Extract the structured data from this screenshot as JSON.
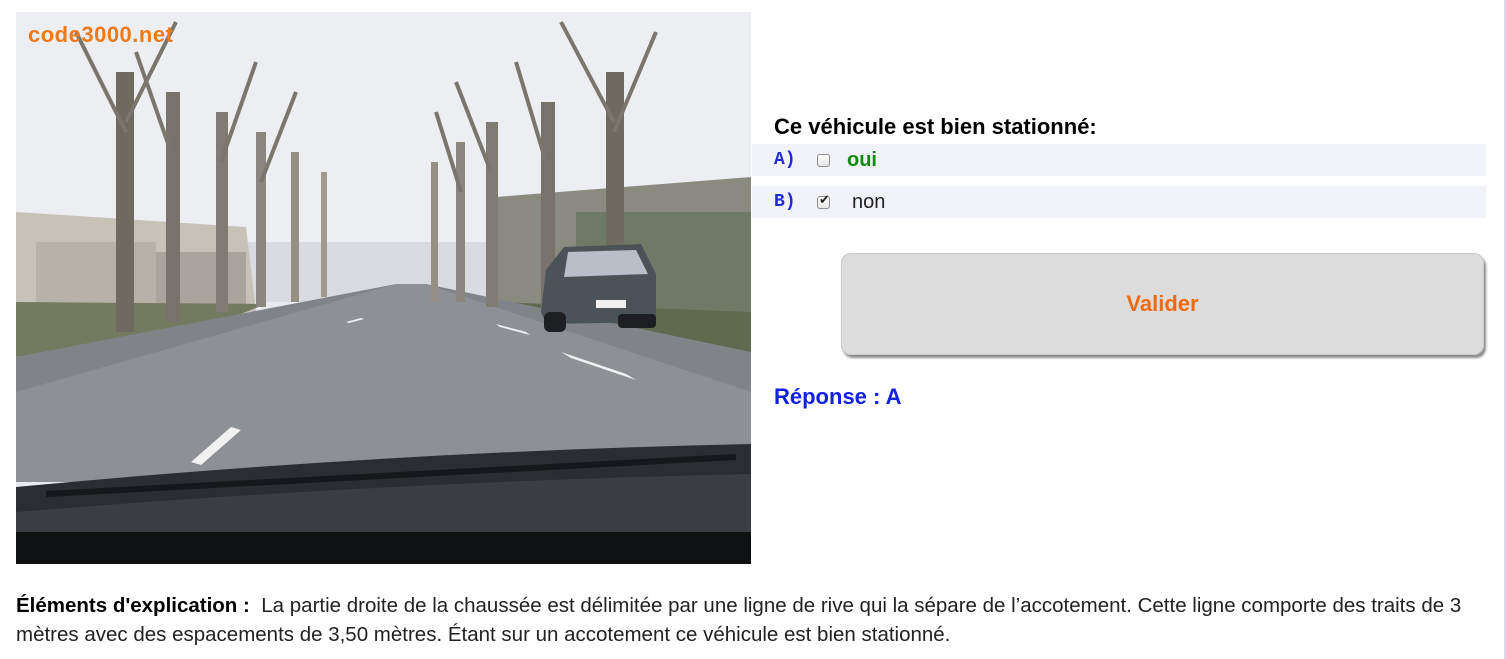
{
  "photo": {
    "watermark": "code3000.net",
    "icon": "road-scene-image"
  },
  "question": {
    "text": "Ce véhicule est bien stationné:"
  },
  "options": [
    {
      "letter": "A)",
      "label": "oui",
      "checked": false
    },
    {
      "letter": "B)",
      "label": "non",
      "checked": true
    }
  ],
  "actions": {
    "validate_label": "Valider"
  },
  "answer": {
    "text": "Réponse : A"
  },
  "explanation": {
    "label": "Éléments d'explication :",
    "text": "La partie droite de la chaussée est délimitée par une ligne de rive qui la sépare de l’accotement. Cette ligne comporte des traits de 3 mètres avec des espacements de 3,50 mètres. Étant sur un accotement ce véhicule est bien stationné."
  },
  "colors": {
    "correct_option": "#128a12",
    "letter": "#1f2bd6",
    "validate_text": "#f06a12",
    "answer": "#1220e0"
  }
}
